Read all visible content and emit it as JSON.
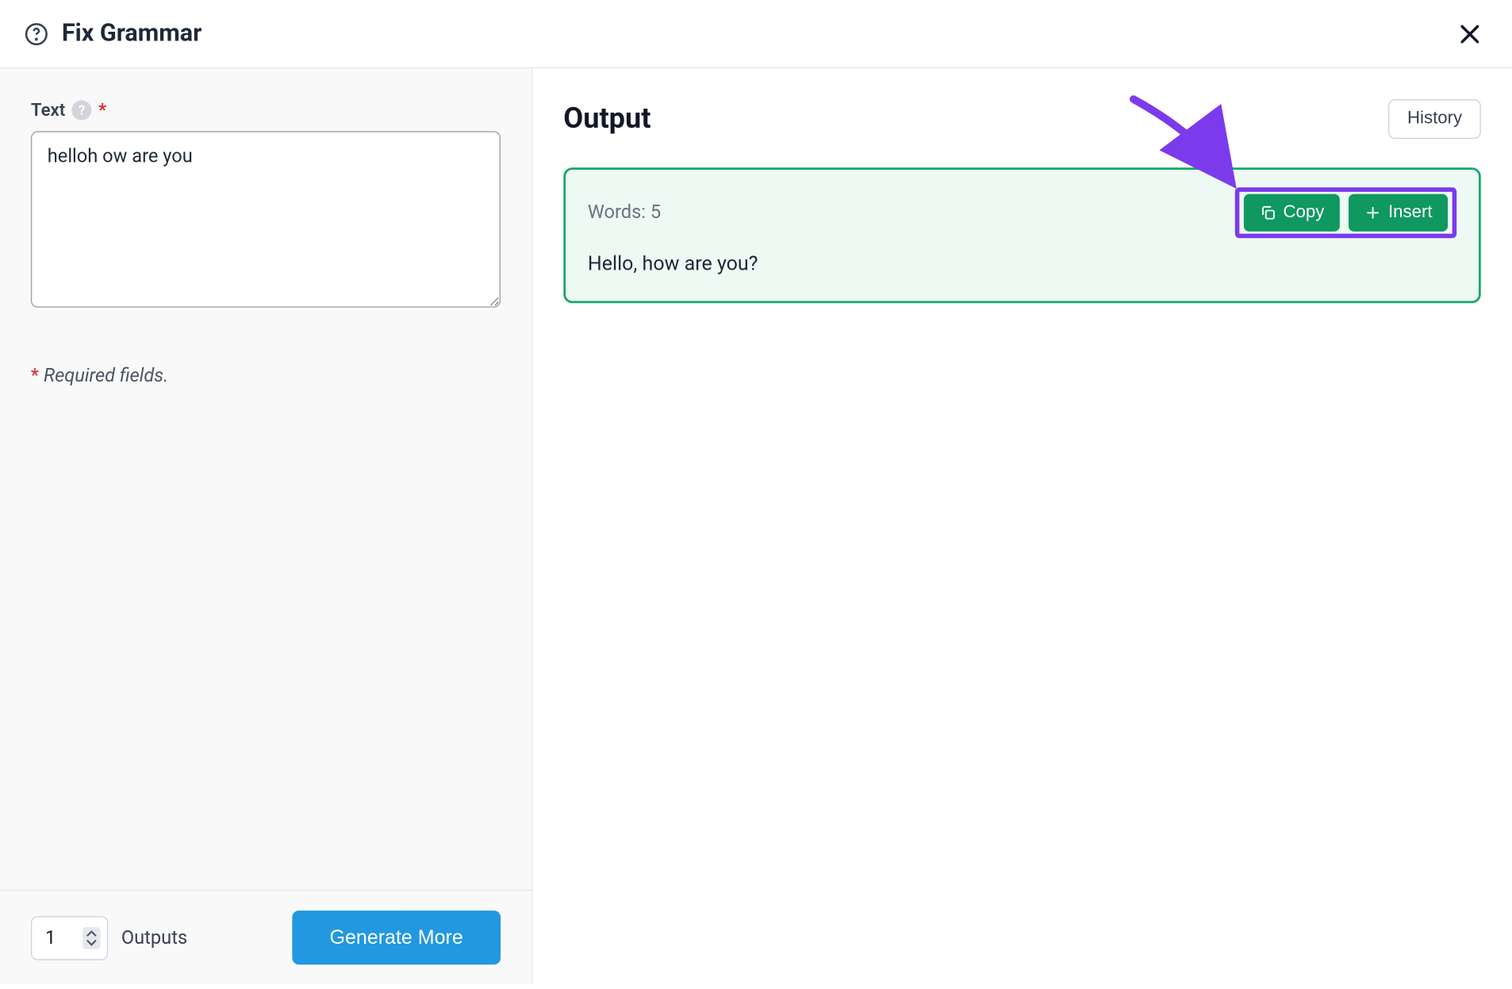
{
  "header": {
    "title": "Fix Grammar"
  },
  "leftPanel": {
    "fieldLabel": "Text",
    "textValue": "helloh ow are you",
    "requiredNote": "Required fields."
  },
  "footer": {
    "outputsValue": "1",
    "outputsLabel": "Outputs",
    "generateLabel": "Generate More"
  },
  "rightPanel": {
    "outputTitle": "Output",
    "historyLabel": "History",
    "card": {
      "wordsLabel": "Words: 5",
      "copyLabel": "Copy",
      "insertLabel": "Insert",
      "text": "Hello, how are you?"
    }
  }
}
